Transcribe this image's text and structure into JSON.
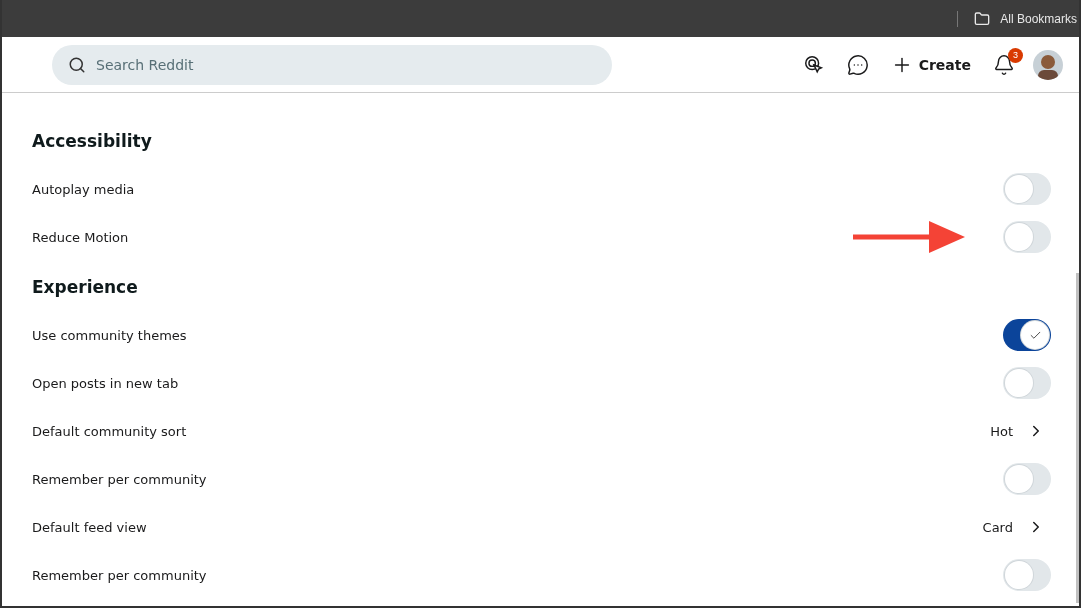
{
  "browser_bar": {
    "bookmarks_label": "All Bookmarks"
  },
  "header": {
    "search": {
      "placeholder": "Search Reddit"
    },
    "create_label": "Create",
    "notification_count": "3"
  },
  "sections": [
    {
      "title": "Accessibility",
      "rows": [
        {
          "kind": "toggle",
          "label": "Autoplay media",
          "on": false,
          "highlighted": false
        },
        {
          "kind": "toggle",
          "label": "Reduce Motion",
          "on": false,
          "highlighted": true
        }
      ]
    },
    {
      "title": "Experience",
      "rows": [
        {
          "kind": "toggle",
          "label": "Use community themes",
          "on": true,
          "highlighted": false
        },
        {
          "kind": "toggle",
          "label": "Open posts in new tab",
          "on": false,
          "highlighted": false
        },
        {
          "kind": "select",
          "label": "Default community sort",
          "value": "Hot"
        },
        {
          "kind": "toggle",
          "label": "Remember per community",
          "on": false,
          "highlighted": false
        },
        {
          "kind": "select",
          "label": "Default feed view",
          "value": "Card"
        },
        {
          "kind": "toggle",
          "label": "Remember per community",
          "on": false,
          "highlighted": false
        }
      ]
    }
  ]
}
